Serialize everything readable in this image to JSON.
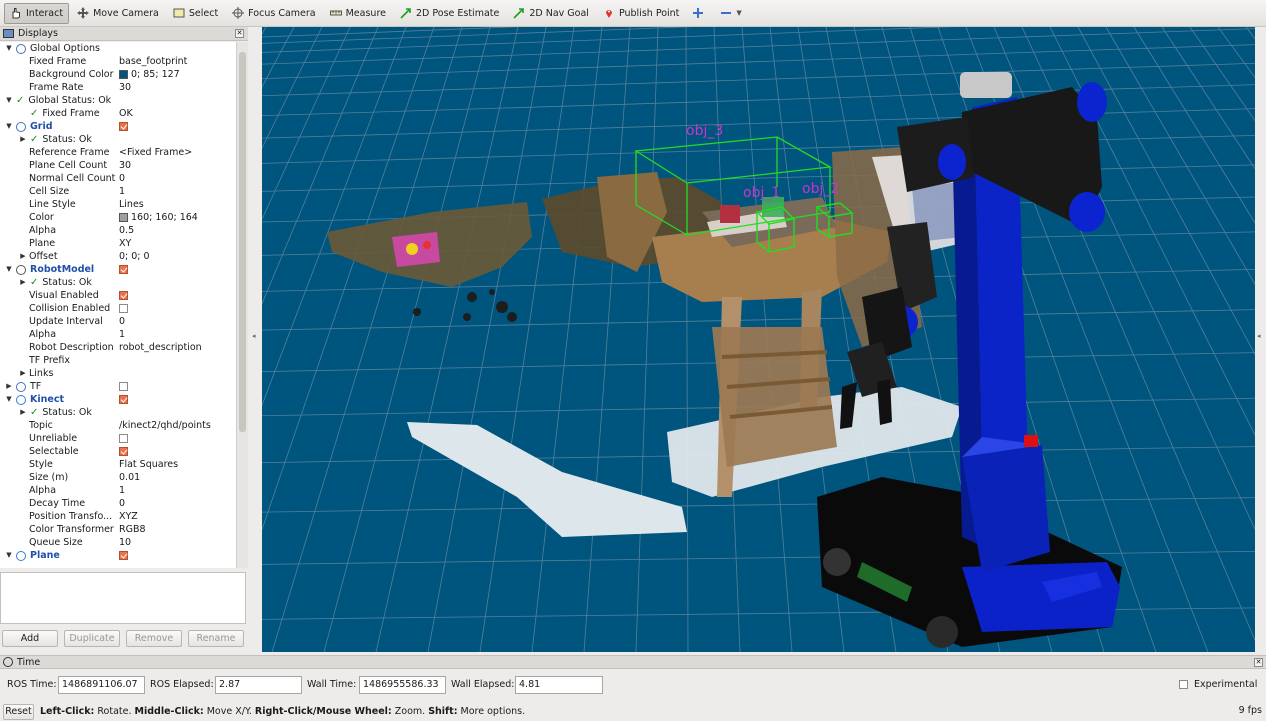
{
  "toolbar": {
    "interact": "Interact",
    "move_camera": "Move Camera",
    "select": "Select",
    "focus_camera": "Focus Camera",
    "measure": "Measure",
    "pose_estimate": "2D Pose Estimate",
    "nav_goal": "2D Nav Goal",
    "publish_point": "Publish Point"
  },
  "displays": {
    "title": "Displays",
    "rows": [
      {
        "name": "Global Options",
        "value": ""
      },
      {
        "name": "Fixed Frame",
        "value": "base_footprint"
      },
      {
        "name": "Background Color",
        "value": "0; 85; 127"
      },
      {
        "name": "Frame Rate",
        "value": "30"
      },
      {
        "name": "Global Status: Ok",
        "value": ""
      },
      {
        "name": "Fixed Frame",
        "value": "OK"
      },
      {
        "name": "Grid",
        "value": ""
      },
      {
        "name": "Status: Ok",
        "value": ""
      },
      {
        "name": "Reference Frame",
        "value": "<Fixed Frame>"
      },
      {
        "name": "Plane Cell Count",
        "value": "30"
      },
      {
        "name": "Normal Cell Count",
        "value": "0"
      },
      {
        "name": "Cell Size",
        "value": "1"
      },
      {
        "name": "Line Style",
        "value": "Lines"
      },
      {
        "name": "Color",
        "value": "160; 160; 164"
      },
      {
        "name": "Alpha",
        "value": "0.5"
      },
      {
        "name": "Plane",
        "value": "XY"
      },
      {
        "name": "Offset",
        "value": "0; 0; 0"
      },
      {
        "name": "RobotModel",
        "value": ""
      },
      {
        "name": "Status: Ok",
        "value": ""
      },
      {
        "name": "Visual Enabled",
        "value": ""
      },
      {
        "name": "Collision Enabled",
        "value": ""
      },
      {
        "name": "Update Interval",
        "value": "0"
      },
      {
        "name": "Alpha",
        "value": "1"
      },
      {
        "name": "Robot Description",
        "value": "robot_description"
      },
      {
        "name": "TF Prefix",
        "value": ""
      },
      {
        "name": "Links",
        "value": ""
      },
      {
        "name": "TF",
        "value": ""
      },
      {
        "name": "Kinect",
        "value": ""
      },
      {
        "name": "Status: Ok",
        "value": ""
      },
      {
        "name": "Topic",
        "value": "/kinect2/qhd/points"
      },
      {
        "name": "Unreliable",
        "value": ""
      },
      {
        "name": "Selectable",
        "value": ""
      },
      {
        "name": "Style",
        "value": "Flat Squares"
      },
      {
        "name": "Size (m)",
        "value": "0.01"
      },
      {
        "name": "Alpha",
        "value": "1"
      },
      {
        "name": "Decay Time",
        "value": "0"
      },
      {
        "name": "Position Transfo...",
        "value": "XYZ"
      },
      {
        "name": "Color Transformer",
        "value": "RGB8"
      },
      {
        "name": "Queue Size",
        "value": "10"
      },
      {
        "name": "Plane",
        "value": ""
      }
    ],
    "buttons": {
      "add": "Add",
      "duplicate": "Duplicate",
      "remove": "Remove",
      "rename": "Rename"
    }
  },
  "colors": {
    "background": "#00557f",
    "grid_color": "#a0a0a4",
    "object_box": "#22dd22",
    "object_label": "#cc33cc"
  },
  "scene": {
    "labels": {
      "obj1": "obj_1",
      "obj2": "obj_2",
      "obj3": "obj_3"
    }
  },
  "time": {
    "title": "Time",
    "ros_time_label": "ROS Time:",
    "ros_time": "1486891106.07",
    "ros_elapsed_label": "ROS Elapsed:",
    "ros_elapsed": "2.87",
    "wall_time_label": "Wall Time:",
    "wall_time": "1486955586.33",
    "wall_elapsed_label": "Wall Elapsed:",
    "wall_elapsed": "4.81",
    "experimental": "Experimental"
  },
  "status": {
    "reset": "Reset",
    "hint_parts": [
      "Left-Click:",
      " Rotate. ",
      "Middle-Click:",
      " Move X/Y. ",
      "Right-Click/Mouse Wheel:",
      " Zoom. ",
      "Shift:",
      " More options."
    ],
    "fps": "9 fps"
  }
}
